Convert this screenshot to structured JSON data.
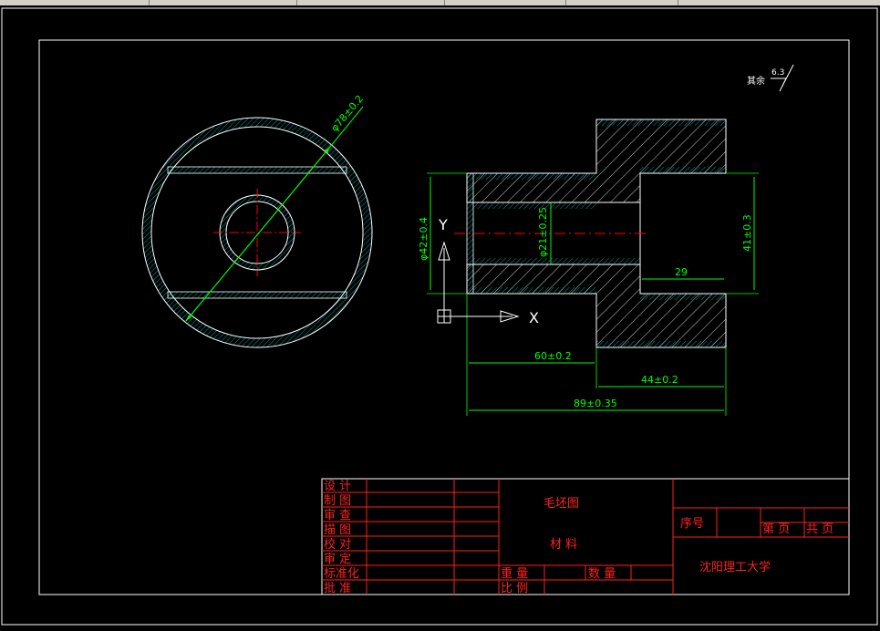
{
  "drawing": {
    "colors": {
      "background": "#000000",
      "frame": "#ffffff",
      "geometry": "#ffffff",
      "hatch": "#00ffff",
      "dimension": "#00ff00",
      "centerline": "#ff0000",
      "titleblock": "#ff2020"
    },
    "surface_finish": {
      "label": "其余",
      "value": "6.3"
    },
    "left_view": {
      "diameter_label": "φ78±0.2"
    },
    "section_view": {
      "dims": {
        "d42": "φ42±0.4",
        "d21": "φ21±0.25",
        "d41": "41±0.3",
        "len29": "29",
        "len60": "60±0.2",
        "len44": "44±0.2",
        "len89": "89±0.35"
      }
    },
    "ucs": {
      "x_label": "X",
      "y_label": "Y"
    }
  },
  "titleblock": {
    "rows": [
      "设 计",
      "制 图",
      "审 查",
      "描 图",
      "校 对",
      "审 定",
      "标准化",
      "批 准"
    ],
    "drawing_name": "毛坯图",
    "material_label": "材 料",
    "weight_label": "重 量",
    "qty_label": "数 量",
    "scale_label": "比 例",
    "serial_label": "序号",
    "sheet_label": "第 页",
    "total_label": "共 页",
    "school": "沈阳理工大学"
  }
}
